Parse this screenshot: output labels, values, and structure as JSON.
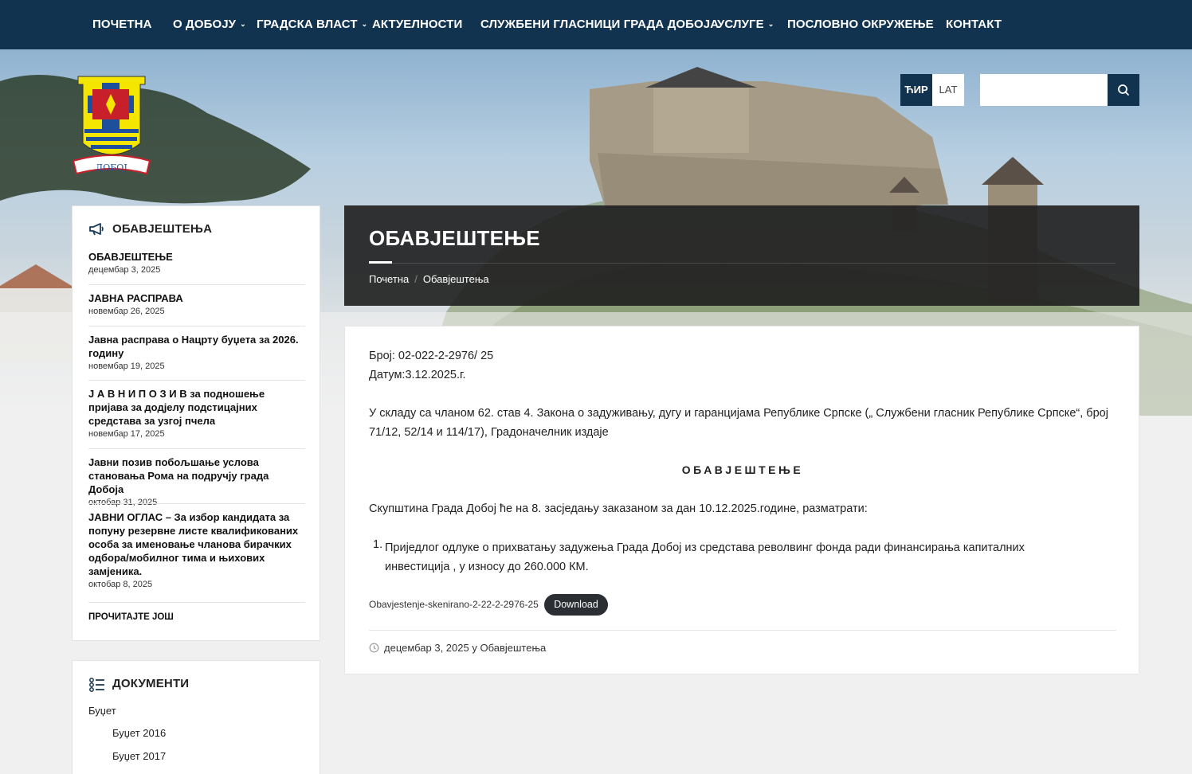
{
  "nav": {
    "items": [
      {
        "label": "ПОЧЕТНА",
        "has_dropdown": false
      },
      {
        "label": "О ДОБОЈУ",
        "has_dropdown": true
      },
      {
        "label": "ГРАДСКА ВЛАСТ",
        "has_dropdown": true
      },
      {
        "label": "АКТУЕЛНОСТИ",
        "has_dropdown": false
      },
      {
        "label": "СЛУЖБЕНИ ГЛАСНИЦИ ГРАДА ДОБОЈА",
        "has_dropdown": false
      },
      {
        "label": "УСЛУГЕ",
        "has_dropdown": true
      },
      {
        "label": "ПОСЛОВНО ОКРУЖЕЊЕ",
        "has_dropdown": false
      },
      {
        "label": "КОНТАКТ",
        "has_dropdown": false
      }
    ]
  },
  "lang": {
    "cyr": "ЋИР",
    "lat": "LAT"
  },
  "search": {
    "placeholder": "",
    "icon": "search-icon"
  },
  "logo": {
    "text": "ДОБОЈ"
  },
  "sidebar": {
    "announcements": {
      "title": "ОБАВЈЕШТЕЊА",
      "icon": "megaphone-icon",
      "posts": [
        {
          "title": "ОБАВЈЕШТЕЊЕ",
          "date": "децембар 3, 2025"
        },
        {
          "title": "ЈАВНА РАСПРАВА",
          "date": "новембар 26, 2025"
        },
        {
          "title": "Јавна расправа о Нацрту буџета за 2026. годину",
          "date": "новембар 19, 2025"
        },
        {
          "title": "Ј А В Н И   П О З И В за  подношење пријава за  додјелу подстицајних средстава за узгој пчела",
          "date": "новембар 17, 2025"
        },
        {
          "title": "Јавни позив побољшање услова становања Рома на подручју града Добоја",
          "date": "октобар 31, 2025"
        },
        {
          "title": "ЈАВНИ ОГЛАС – За избор кандидата за попуну резервне листе квалификованих особа за именовање чланова бирачких одбора/мобилног тима и њихових замјеника.",
          "date": "октобар 8, 2025"
        }
      ],
      "read_more": "ПРОЧИТАЈТЕ ЈОШ"
    },
    "documents": {
      "title": "ДОКУМЕНТИ",
      "icon": "list-icon",
      "items": [
        {
          "label": "Буџет"
        },
        {
          "label": "Буџет 2016"
        },
        {
          "label": "Буџет 2017"
        }
      ]
    }
  },
  "page": {
    "title": "ОБАВЈЕШТЕЊЕ",
    "breadcrumb": [
      "Почетна",
      "Обавјештења"
    ],
    "breadcrumb_sep": "/"
  },
  "article": {
    "number": "Број: 02-022-2-2976/ 25",
    "date": "Датум:3.12.2025.г.",
    "intro": "У складу са чланом 62. став 4. Закона о задуживању, дугу и гаранцијама Републике Српске („ Службени гласник Републике Српске“, број 71/12, 52/14 и 114/17), Градоначелник издаје",
    "heading": "ОБАВЈЕШТЕЊЕ",
    "body": "Скупштина Града Добој ће на 8. засједању заказаном за дан 10.12.2025.године, разматрати:",
    "list": [
      {
        "num": "1.",
        "text": "Приједлог одлуке о прихватању задужења Града Добој из средстава револвинг фонда ради финансирања капиталних инвестиција , у износу до 260.000 КМ."
      }
    ],
    "file_name": "Obavjestenje-skenirano-2-22-2-2976-25",
    "download_label": "Download",
    "meta_date": "децембар 3, 2025",
    "meta_in": "у",
    "meta_category": "Обавјештења"
  },
  "colors": {
    "nav_bg": "#11334f",
    "banner_bg": "#1e1e1e",
    "button_dark": "#2b2e33"
  }
}
